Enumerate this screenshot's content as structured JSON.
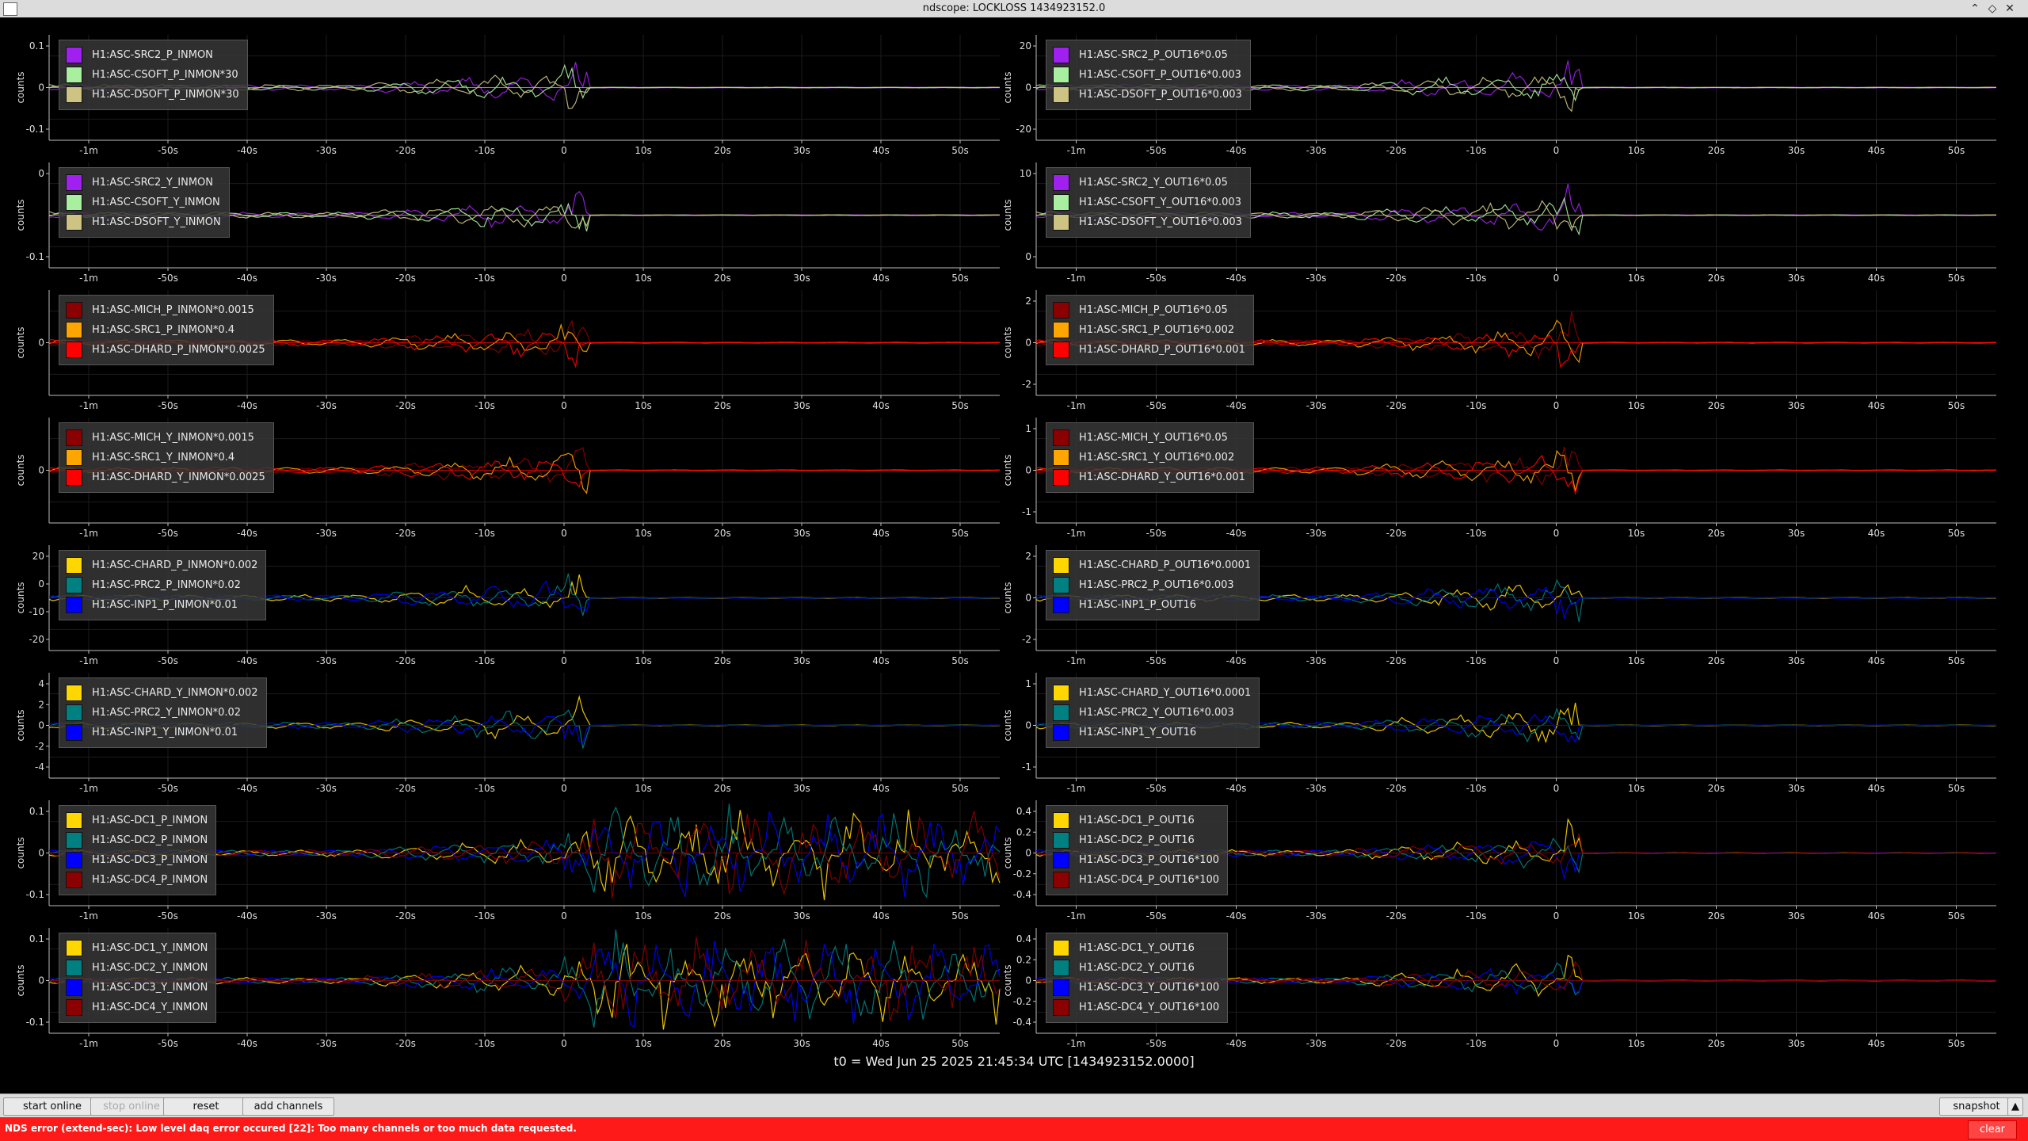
{
  "window": {
    "title": "ndscope: LOCKLOSS 1434923152.0"
  },
  "panels": [
    {
      "side": "left",
      "ylabel": "counts",
      "yticks": [
        "0.1",
        "0",
        "-0.1"
      ],
      "channels": [
        {
          "name": "H1:ASC-SRC2_P_INMON",
          "color": "#a020f0"
        },
        {
          "name": "H1:ASC-CSOFT_P_INMON*30",
          "color": "#a8f0a0"
        },
        {
          "name": "H1:ASC-DSOFT_P_INMON*30",
          "color": "#cdc383"
        }
      ]
    },
    {
      "side": "right",
      "ylabel": "counts",
      "yticks": [
        "20",
        "0",
        "-20"
      ],
      "channels": [
        {
          "name": "H1:ASC-SRC2_P_OUT16*0.05",
          "color": "#a020f0"
        },
        {
          "name": "H1:ASC-CSOFT_P_OUT16*0.003",
          "color": "#a8f0a0"
        },
        {
          "name": "H1:ASC-DSOFT_P_OUT16*0.003",
          "color": "#cdc383"
        }
      ]
    },
    {
      "side": "left",
      "ylabel": "counts",
      "yticks": [
        "0",
        "-0.1"
      ],
      "channels": [
        {
          "name": "H1:ASC-SRC2_Y_INMON",
          "color": "#a020f0"
        },
        {
          "name": "H1:ASC-CSOFT_Y_INMON",
          "color": "#a8f0a0"
        },
        {
          "name": "H1:ASC-DSOFT_Y_INMON",
          "color": "#cdc383"
        }
      ]
    },
    {
      "side": "right",
      "ylabel": "counts",
      "yticks": [
        "10",
        "0"
      ],
      "channels": [
        {
          "name": "H1:ASC-SRC2_Y_OUT16*0.05",
          "color": "#a020f0"
        },
        {
          "name": "H1:ASC-CSOFT_Y_OUT16*0.003",
          "color": "#a8f0a0"
        },
        {
          "name": "H1:ASC-DSOFT_Y_OUT16*0.003",
          "color": "#cdc383"
        }
      ]
    },
    {
      "side": "left",
      "ylabel": "counts",
      "yticks": [
        "0"
      ],
      "channels": [
        {
          "name": "H1:ASC-MICH_P_INMON*0.0015",
          "color": "#8b0000"
        },
        {
          "name": "H1:ASC-SRC1_P_INMON*0.4",
          "color": "#ffa500"
        },
        {
          "name": "H1:ASC-DHARD_P_INMON*0.0025",
          "color": "#ff0000"
        }
      ]
    },
    {
      "side": "right",
      "ylabel": "counts",
      "yticks": [
        "2",
        "0",
        "-2"
      ],
      "channels": [
        {
          "name": "H1:ASC-MICH_P_OUT16*0.05",
          "color": "#8b0000"
        },
        {
          "name": "H1:ASC-SRC1_P_OUT16*0.002",
          "color": "#ffa500"
        },
        {
          "name": "H1:ASC-DHARD_P_OUT16*0.001",
          "color": "#ff0000"
        }
      ]
    },
    {
      "side": "left",
      "ylabel": "counts",
      "yticks": [
        "0"
      ],
      "channels": [
        {
          "name": "H1:ASC-MICH_Y_INMON*0.0015",
          "color": "#8b0000"
        },
        {
          "name": "H1:ASC-SRC1_Y_INMON*0.4",
          "color": "#ffa500"
        },
        {
          "name": "H1:ASC-DHARD_Y_INMON*0.0025",
          "color": "#ff0000"
        }
      ]
    },
    {
      "side": "right",
      "ylabel": "counts",
      "yticks": [
        "1",
        "0",
        "-1"
      ],
      "channels": [
        {
          "name": "H1:ASC-MICH_Y_OUT16*0.05",
          "color": "#8b0000"
        },
        {
          "name": "H1:ASC-SRC1_Y_OUT16*0.002",
          "color": "#ffa500"
        },
        {
          "name": "H1:ASC-DHARD_Y_OUT16*0.001",
          "color": "#ff0000"
        }
      ]
    },
    {
      "side": "left",
      "ylabel": "counts",
      "yticks": [
        "20",
        "0",
        "-10",
        "-20"
      ],
      "channels": [
        {
          "name": "H1:ASC-CHARD_P_INMON*0.002",
          "color": "#ffd700"
        },
        {
          "name": "H1:ASC-PRC2_P_INMON*0.02",
          "color": "#008080"
        },
        {
          "name": "H1:ASC-INP1_P_INMON*0.01",
          "color": "#0000ff"
        }
      ]
    },
    {
      "side": "right",
      "ylabel": "counts",
      "yticks": [
        "2",
        "0",
        "-2"
      ],
      "channels": [
        {
          "name": "H1:ASC-CHARD_P_OUT16*0.0001",
          "color": "#ffd700"
        },
        {
          "name": "H1:ASC-PRC2_P_OUT16*0.003",
          "color": "#008080"
        },
        {
          "name": "H1:ASC-INP1_P_OUT16",
          "color": "#0000ff"
        }
      ]
    },
    {
      "side": "left",
      "ylabel": "counts",
      "yticks": [
        "4",
        "2",
        "0",
        "-2",
        "-4"
      ],
      "channels": [
        {
          "name": "H1:ASC-CHARD_Y_INMON*0.002",
          "color": "#ffd700"
        },
        {
          "name": "H1:ASC-PRC2_Y_INMON*0.02",
          "color": "#008080"
        },
        {
          "name": "H1:ASC-INP1_Y_INMON*0.01",
          "color": "#0000ff"
        }
      ]
    },
    {
      "side": "right",
      "ylabel": "counts",
      "yticks": [
        "1",
        "0",
        "-1"
      ],
      "channels": [
        {
          "name": "H1:ASC-CHARD_Y_OUT16*0.0001",
          "color": "#ffd700"
        },
        {
          "name": "H1:ASC-PRC2_Y_OUT16*0.003",
          "color": "#008080"
        },
        {
          "name": "H1:ASC-INP1_Y_OUT16",
          "color": "#0000ff"
        }
      ]
    },
    {
      "side": "left",
      "ylabel": "counts",
      "yticks": [
        "0.1",
        "0",
        "-0.1"
      ],
      "channels": [
        {
          "name": "H1:ASC-DC1_P_INMON",
          "color": "#ffd700"
        },
        {
          "name": "H1:ASC-DC2_P_INMON",
          "color": "#008080"
        },
        {
          "name": "H1:ASC-DC3_P_INMON",
          "color": "#0000ff"
        },
        {
          "name": "H1:ASC-DC4_P_INMON",
          "color": "#8b0000"
        }
      ]
    },
    {
      "side": "right",
      "ylabel": "counts",
      "yticks": [
        "0.4",
        "0.2",
        "0",
        "-0.2",
        "-0.4"
      ],
      "channels": [
        {
          "name": "H1:ASC-DC1_P_OUT16",
          "color": "#ffd700"
        },
        {
          "name": "H1:ASC-DC2_P_OUT16",
          "color": "#008080"
        },
        {
          "name": "H1:ASC-DC3_P_OUT16*100",
          "color": "#0000ff"
        },
        {
          "name": "H1:ASC-DC4_P_OUT16*100",
          "color": "#8b0000"
        }
      ]
    },
    {
      "side": "left",
      "ylabel": "counts",
      "yticks": [
        "0.1",
        "0",
        "-0.1"
      ],
      "channels": [
        {
          "name": "H1:ASC-DC1_Y_INMON",
          "color": "#ffd700"
        },
        {
          "name": "H1:ASC-DC2_Y_INMON",
          "color": "#008080"
        },
        {
          "name": "H1:ASC-DC3_Y_INMON",
          "color": "#0000ff"
        },
        {
          "name": "H1:ASC-DC4_Y_INMON",
          "color": "#8b0000"
        }
      ]
    },
    {
      "side": "right",
      "ylabel": "counts",
      "yticks": [
        "0.4",
        "0.2",
        "0",
        "-0.2",
        "-0.4"
      ],
      "channels": [
        {
          "name": "H1:ASC-DC1_Y_OUT16",
          "color": "#ffd700"
        },
        {
          "name": "H1:ASC-DC2_Y_OUT16",
          "color": "#008080"
        },
        {
          "name": "H1:ASC-DC3_Y_OUT16*100",
          "color": "#0000ff"
        },
        {
          "name": "H1:ASC-DC4_Y_OUT16*100",
          "color": "#8b0000"
        }
      ]
    }
  ],
  "xticks_left": [
    "-1m",
    "-50s",
    "-40s",
    "-30s",
    "-20s",
    "-10s",
    "0",
    "10s",
    "20s",
    "30s",
    "40s",
    "50s"
  ],
  "xticks_right": [
    "-1m",
    "-50s",
    "-40s",
    "-30s",
    "-20s",
    "-10s",
    "0",
    "10s",
    "20s",
    "30s",
    "40s",
    "50s"
  ],
  "t0_text": "t0 = Wed Jun 25 2025 21:45:34 UTC [1434923152.0000]",
  "toolbar": {
    "start_online": "start online",
    "stop_online": "stop online",
    "reset": "reset",
    "add_channels": "add channels",
    "snapshot": "snapshot"
  },
  "status": {
    "error_text": "NDS error (extend-sec): Low level daq error occured [22]: Too many channels or too much data requested.",
    "clear_label": "clear"
  }
}
